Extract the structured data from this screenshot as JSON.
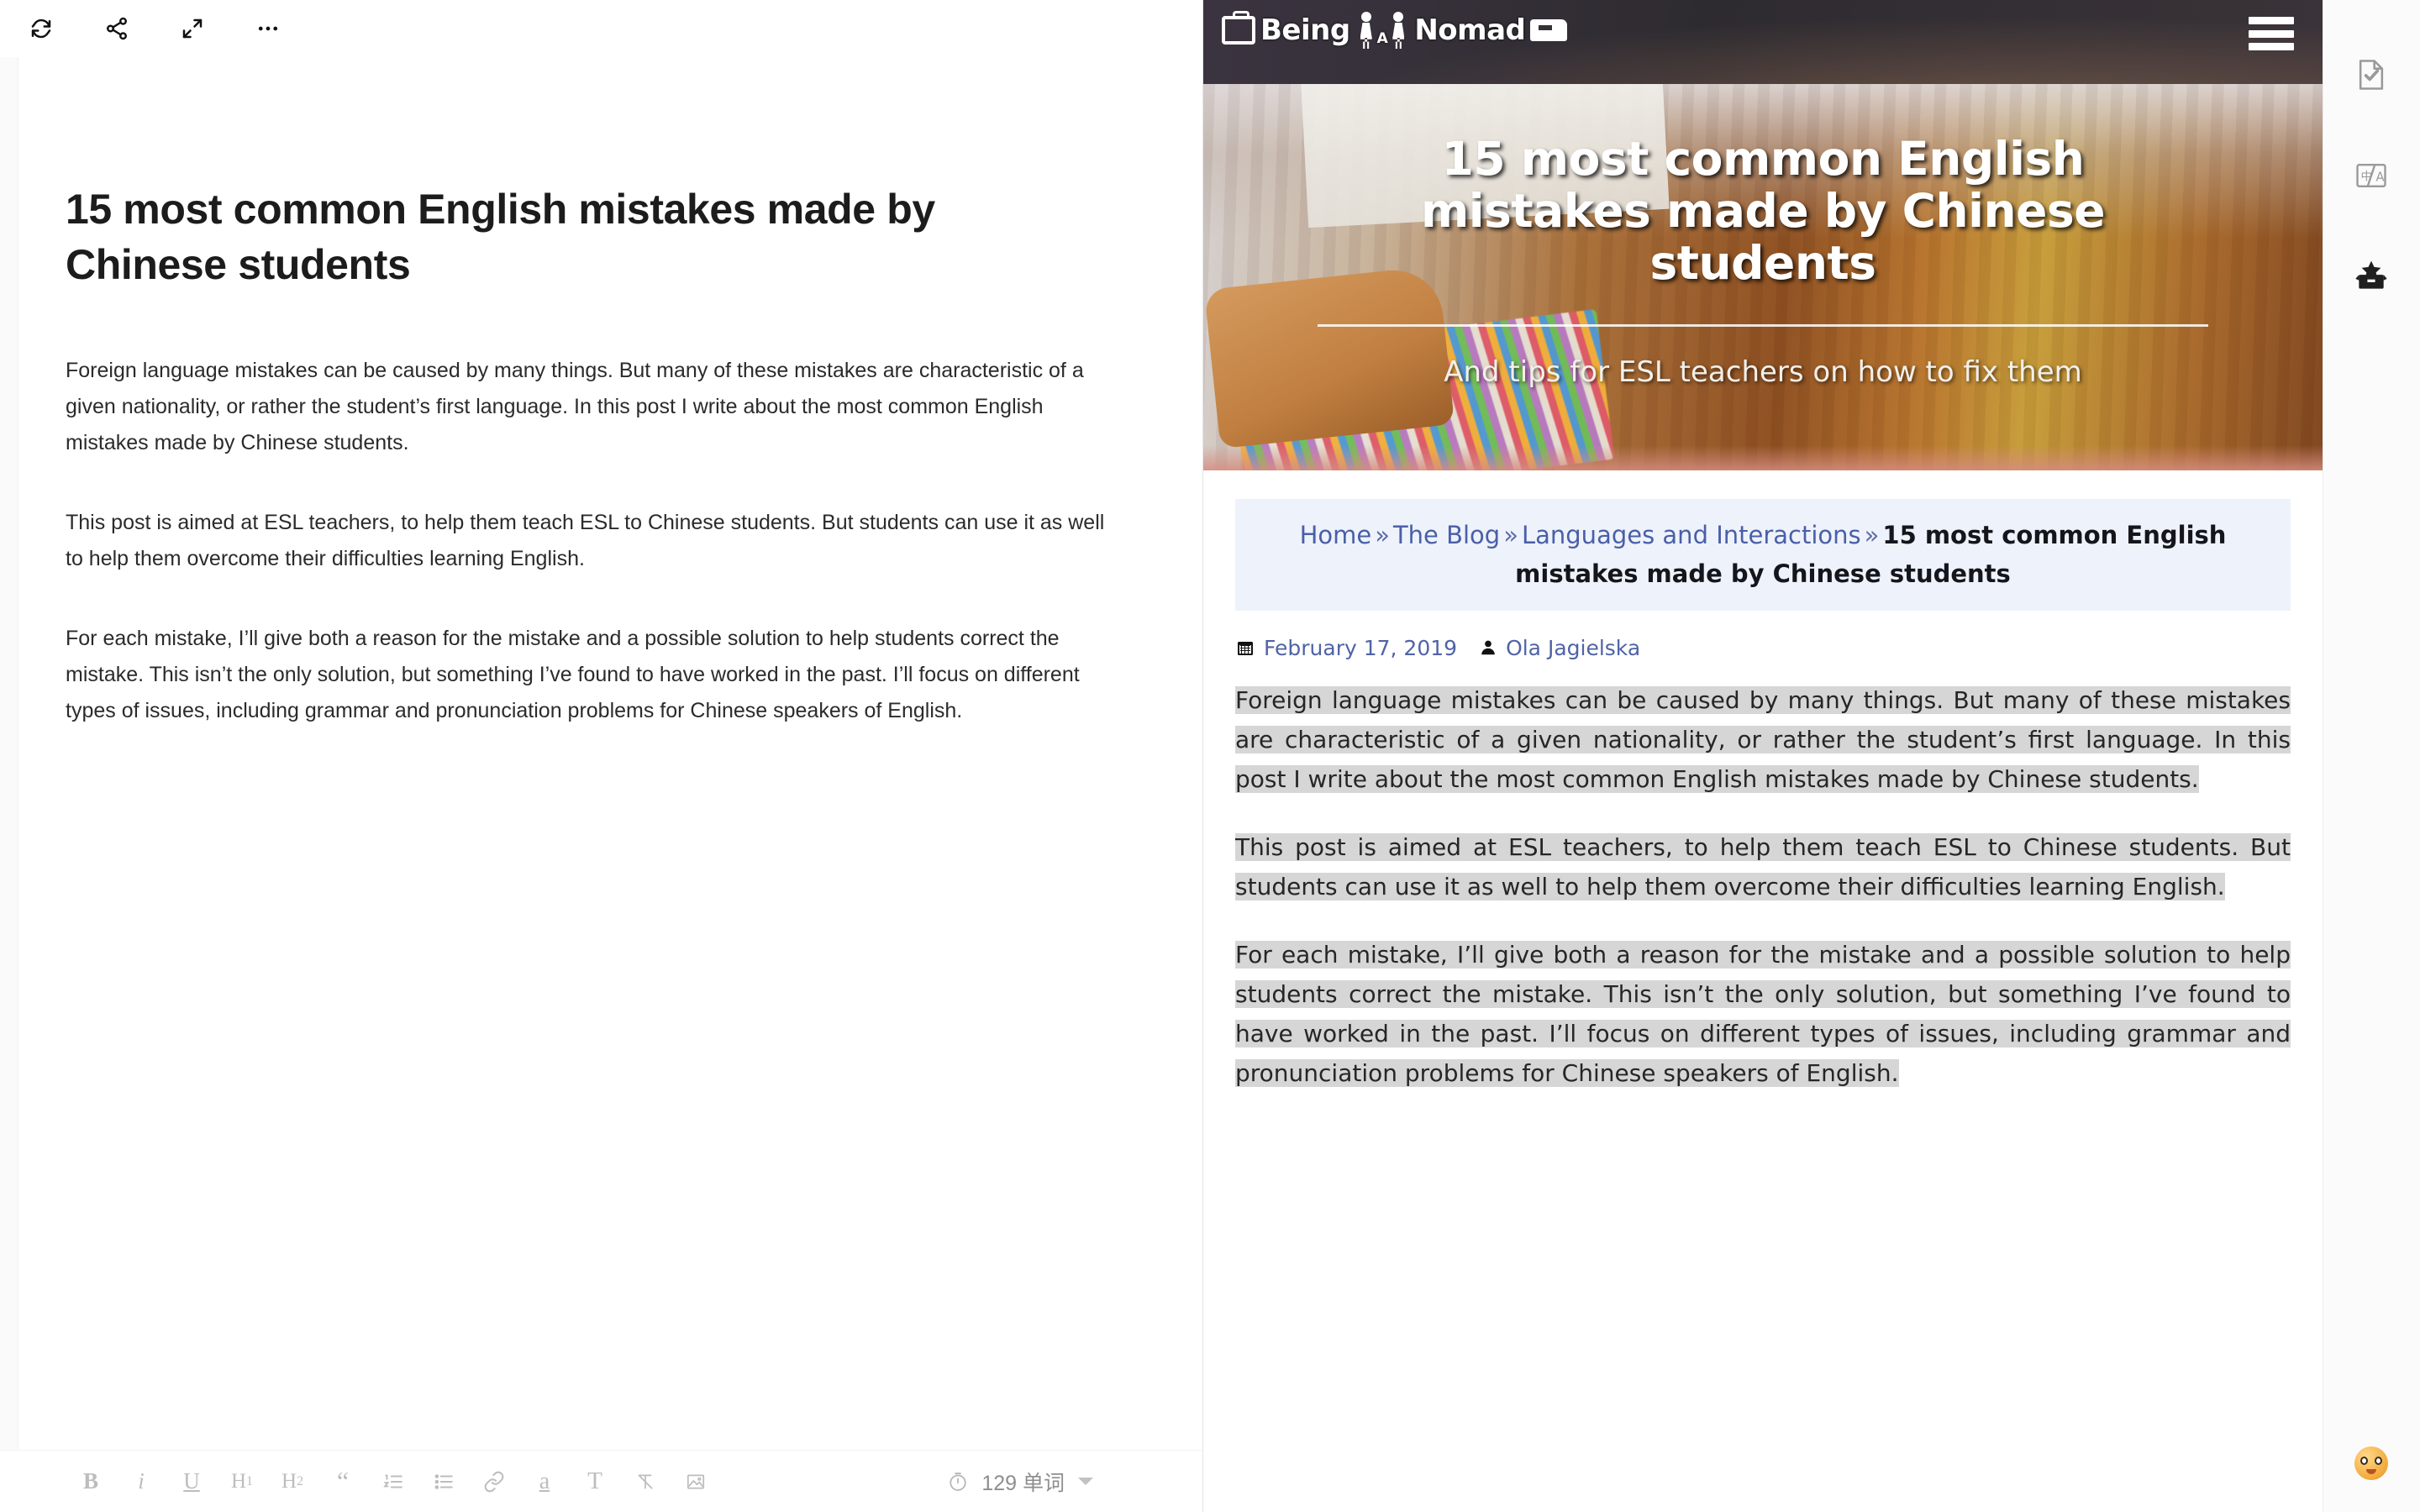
{
  "editor": {
    "toolbar": [
      {
        "name": "sync-icon",
        "label": "Sync"
      },
      {
        "name": "share-icon",
        "label": "Share"
      },
      {
        "name": "fullscreen-icon",
        "label": "Fullscreen"
      },
      {
        "name": "more-icon",
        "label": "More"
      }
    ],
    "title": "15 most common English mistakes made by Chinese students",
    "paragraphs": [
      "Foreign language mistakes can be caused by many things. But many of these mistakes are characteristic of a given nationality, or rather the student’s first language. In this post I write about the most common English mistakes made by Chinese students.",
      "This post is aimed at ESL teachers, to help them teach ESL to Chinese students. But students can use it as well to help them overcome their difficulties learning English.",
      "For each mistake, I’ll give both a reason for the mistake and a possible solution to help students correct the mistake. This isn’t the only solution, but something I’ve found to have worked in the past. I’ll focus on different types of issues, including grammar and pronunciation problems for Chinese speakers of English."
    ],
    "format_bar": [
      {
        "name": "bold-button",
        "label": "B"
      },
      {
        "name": "italic-button",
        "label": "i"
      },
      {
        "name": "underline-button",
        "label": "U"
      },
      {
        "name": "heading1-button",
        "label": "H1"
      },
      {
        "name": "heading2-button",
        "label": "H2"
      },
      {
        "name": "blockquote-button",
        "label": "“"
      },
      {
        "name": "ordered-list-button",
        "label": "ordered-list-icon"
      },
      {
        "name": "bulleted-list-button",
        "label": "bulleted-list-icon"
      },
      {
        "name": "link-button",
        "label": "link-icon"
      },
      {
        "name": "highlight-button",
        "label": "a"
      },
      {
        "name": "text-style-button",
        "label": "T"
      },
      {
        "name": "clear-format-button",
        "label": "clear-format-icon"
      },
      {
        "name": "insert-image-button",
        "label": "image-icon"
      }
    ],
    "status": {
      "timer_icon": "stopwatch-icon",
      "word_count": "129 单词",
      "caret": "chevron-down-icon"
    }
  },
  "preview": {
    "site": {
      "logo_text_1": "Being",
      "logo_a": "A",
      "logo_text_2": "Nomad",
      "menu": "hamburger-menu-icon"
    },
    "hero": {
      "title": "15 most common English mistakes made by Chinese students",
      "subtitle": "And tips for ESL teachers on how to fix them"
    },
    "breadcrumb": {
      "items": [
        {
          "label": "Home",
          "link": true
        },
        {
          "label": "The Blog",
          "link": true
        },
        {
          "label": "Languages and Interactions",
          "link": true
        }
      ],
      "separator": "»",
      "current": "15 most common English mistakes made by Chinese students"
    },
    "meta": {
      "date_icon": "calendar-icon",
      "date": "February 17, 2019",
      "author_icon": "user-icon",
      "author": "Ola Jagielska"
    },
    "paragraphs": [
      "Foreign language mistakes can be caused by many things. But many of these mistakes are characteristic of a given nationality, or rather the student’s first language. In this post I write about the most common English mistakes made by Chinese students.",
      "This post is aimed at ESL teachers, to help them teach ESL to Chinese students. But students can use it as well to help them overcome their difficulties learning English.",
      "For each mistake, I’ll give both a reason for the mistake and a possible solution to help students correct the mistake. This isn’t the only solution, but something I’ve found to have worked in the past. I’ll focus on different types of issues, including grammar and pronunciation problems for Chinese speakers of English."
    ]
  },
  "tool_rail": {
    "items": [
      {
        "name": "proofread-icon",
        "label": "Proofread"
      },
      {
        "name": "translate-icon",
        "label": "Translate"
      },
      {
        "name": "toolbox-icon",
        "label": "Toolbox"
      }
    ],
    "emoji": "emoji-face-icon"
  },
  "colors": {
    "header_bg": "#343237",
    "breadcrumb_bg": "#eef2fb",
    "link": "#4a5fa8",
    "selection": "#d6d6d6"
  }
}
